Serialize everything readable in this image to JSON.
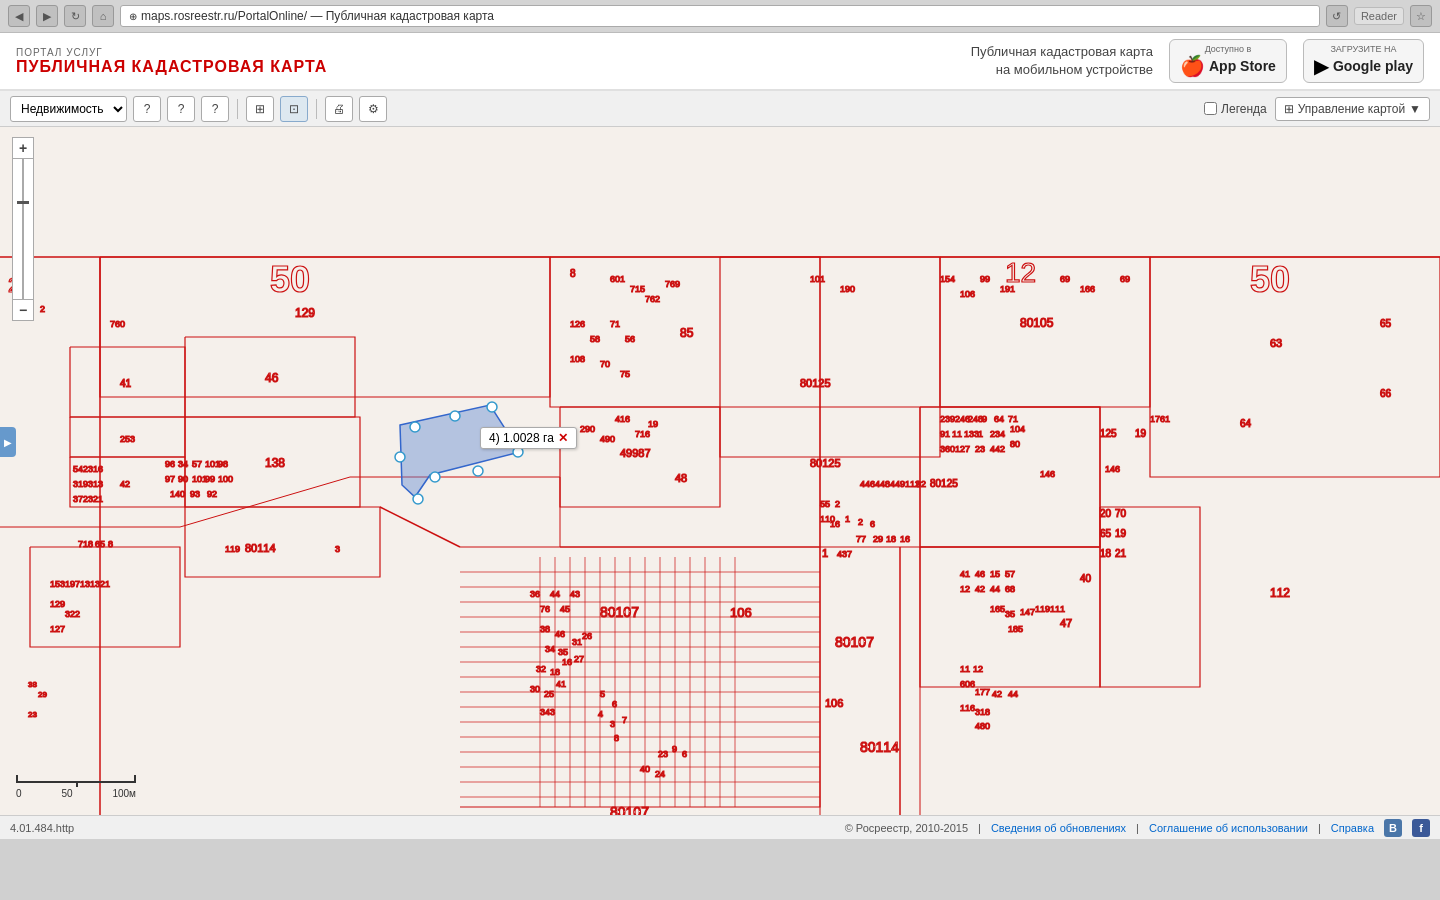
{
  "browser": {
    "url": "maps.rosreestr.ru/PortalOnline/ — Публичная кадастровая карта",
    "reader_label": "Reader"
  },
  "header": {
    "portal_label": "ПОРТАЛ УСЛУГ",
    "title": "ПУБЛИЧНАЯ КАДАСТРОВАЯ КАРТА",
    "mobile_text": "Публичная кадастровая карта\nна мобильном устройстве",
    "appstore_top": "Доступно в",
    "appstore_name": "App Store",
    "googleplay_top": "ЗАГРУЗИТЕ НА",
    "googleplay_name": "Google play"
  },
  "toolbar": {
    "property_select": "Недвижимость",
    "legend_label": "Легенда",
    "manage_map_label": "Управление картой"
  },
  "map": {
    "measurement_label": "4) 1.0028 га"
  },
  "scale": {
    "labels": [
      "0",
      "50",
      "100м"
    ]
  },
  "status": {
    "version": "4.01.484.http",
    "copyright": "© Росреестр, 2010-2015",
    "update_link": "Сведения об обновлениях",
    "agreement_link": "Соглашение об использовании",
    "help_link": "Справка"
  }
}
